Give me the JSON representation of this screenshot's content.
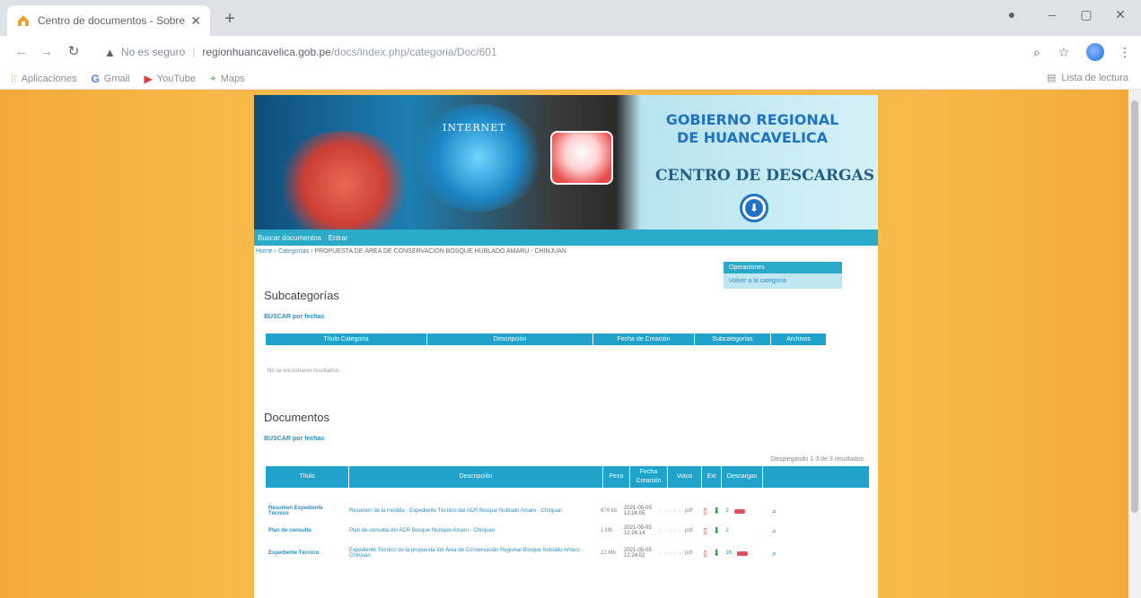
{
  "browser": {
    "tab_title": "Centro de documentos - Sobre",
    "tab_close": "✕",
    "new_tab": "+",
    "url_warning": "No es seguro",
    "url_domain": "regionhuancavelica.gob.pe",
    "url_path": "/docs/index.php/categoria/Doc/601",
    "bookmarks": [
      {
        "label": "Aplicaciones",
        "icon": "apps-icon"
      },
      {
        "label": "Gmail",
        "icon": "google-icon"
      },
      {
        "label": "YouTube",
        "icon": "youtube-icon"
      },
      {
        "label": "Maps",
        "icon": "maps-icon"
      }
    ],
    "reading_list": "Lista de lectura"
  },
  "banner": {
    "internet": "INTERNET",
    "org_line1": "GOBIERNO REGIONAL",
    "org_line2": "DE HUANCAVELICA",
    "center_title": "CENTRO DE DESCARGAS",
    "download_symbol": "⬇"
  },
  "menu": [
    "Buscar documentos",
    "Entrar"
  ],
  "breadcrumb": {
    "home": "Home",
    "sep": "›",
    "categories": "Categorías",
    "current": "PROPUESTA DE ÁREA DE CONSERVACIÓN BOSQUE HUBLADO AMARU - CHINJUAN"
  },
  "operations": {
    "header": "Operaciones",
    "back": "Volver a la categoría"
  },
  "subcategories": {
    "heading": "Subcategorías",
    "search_link": "BUSCAR por fechas",
    "columns": [
      "Título Categoría",
      "Descripción",
      "Fecha de Creación",
      "Subcategorías",
      "Archivos"
    ],
    "empty": "No se encontraron resultados."
  },
  "documents": {
    "heading": "Documentos",
    "search_link": "BUSCAR por fechas",
    "count_msg": "Desplegando 1-3 de 3 resultados.",
    "columns": [
      "Título",
      "Descripción",
      "Peso",
      "Fecha Creación",
      "Votos",
      "Ext",
      "Descargas"
    ],
    "rows": [
      {
        "title": "Resumen Expediente Técnico",
        "desc": "Resumen de la medida - Expediente Técnico del ACR Bosque Nublado Amaru - Chinjuan",
        "size": "874 kb",
        "date": "2021-05-05 12:24:05",
        "votes": "☆☆☆☆☆",
        "ext": "pdf",
        "downloads": "2"
      },
      {
        "title": "Plan de consulta",
        "desc": "Plan de consulta del ACR Bosque Nublado Amaru - Chinjuan",
        "size": "1 Mb",
        "date": "2021-05-05 12:24:14",
        "votes": "☆☆☆☆☆",
        "ext": "pdf",
        "downloads": "2"
      },
      {
        "title": "Expediente Técnico",
        "desc": "Expediente Técnico de la propuesta del Área de Conservación Regional Bosque Nublado Amaru - Chinjuan",
        "size": "22 Mb",
        "date": "2021-05-05 12:24:02",
        "votes": "☆☆☆☆☆",
        "ext": "pdf",
        "downloads": "18"
      }
    ]
  },
  "icons": {
    "pdf": "▯",
    "download": "⬇",
    "view": "⌕"
  },
  "colors": {
    "accent": "#2aa9c9",
    "header_blue": "#1fa3cc",
    "link": "#2b8fc0",
    "page_bg": "#f6b94a"
  }
}
